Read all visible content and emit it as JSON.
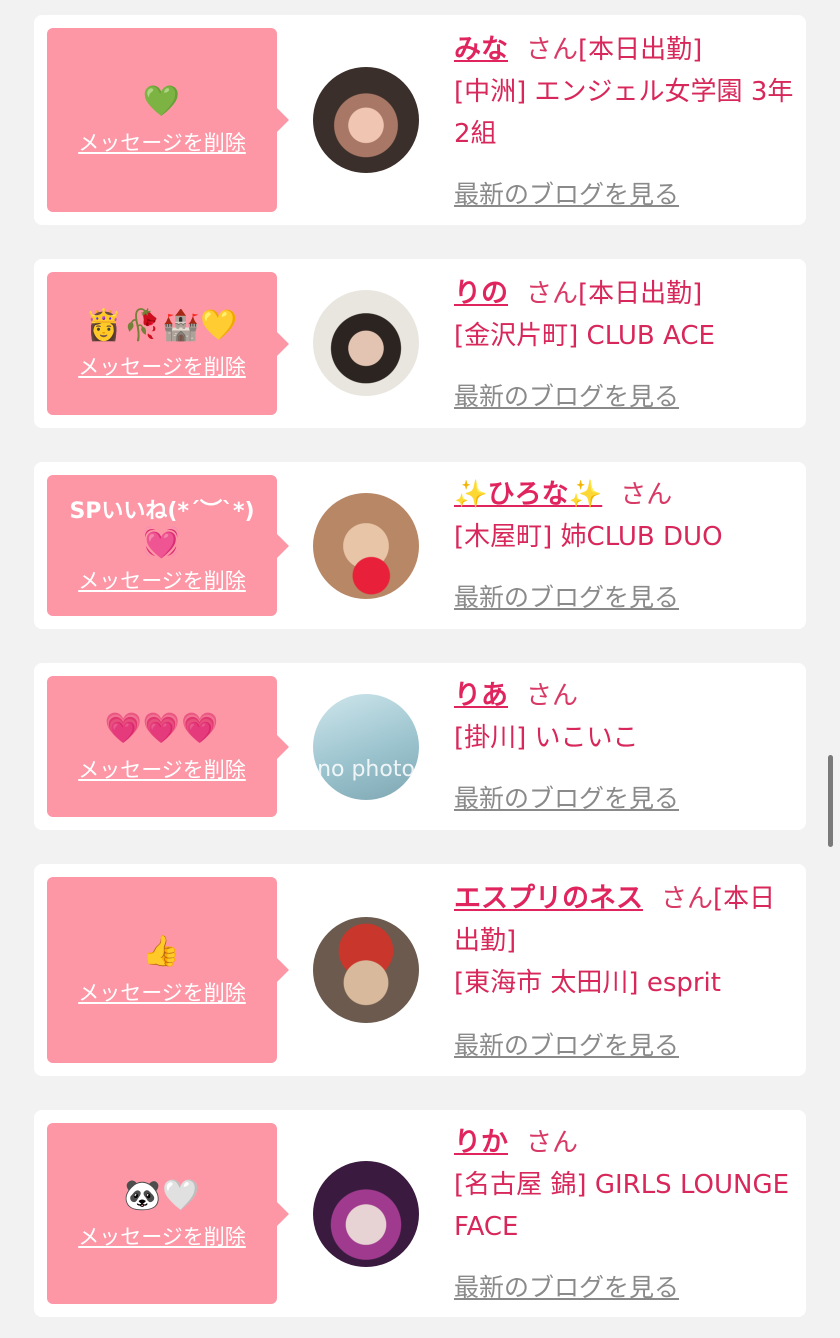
{
  "cards": [
    {
      "message_emoji": "💚",
      "delete_label": "メッセージを削除",
      "avatar_label": "",
      "name": "みな",
      "san": "さん",
      "attendance": "[本日出勤]",
      "shop": "[中洲] エンジェル女学園 3年2組",
      "blog_label": "最新のブログを見る",
      "avatar_colors": [
        "#3a2f2a",
        "#a87765",
        "#f0c6b3"
      ]
    },
    {
      "message_emoji": "👸🥀🏰💛",
      "delete_label": "メッセージを削除",
      "avatar_label": "",
      "name": "りの",
      "san": "さん",
      "attendance": "[本日出勤]",
      "shop": "[金沢片町] CLUB ACE",
      "blog_label": "最新のブログを見る",
      "avatar_colors": [
        "#e9e6df",
        "#2b2420",
        "#e3c3b1"
      ]
    },
    {
      "message_text": "SPいいね(*´︶`*)",
      "message_emoji": "💓",
      "delete_label": "メッセージを削除",
      "avatar_label": "",
      "name": "✨ひろな✨",
      "san": "さん",
      "attendance": "",
      "shop": "[木屋町] 姉CLUB DUO",
      "blog_label": "最新のブログを見る",
      "avatar_colors": [
        "#b88765",
        "#e7c5a6",
        "#e8203a"
      ]
    },
    {
      "message_emoji": "💗💗💗",
      "delete_label": "メッセージを削除",
      "avatar_label": "no photo",
      "name": "りあ",
      "san": "さん",
      "attendance": "",
      "shop": "[掛川] いこいこ",
      "blog_label": "最新のブログを見る",
      "avatar_colors": [
        "#bcdde5",
        "#9cc4cf",
        "#7fa7b3"
      ]
    },
    {
      "message_emoji": "👍",
      "delete_label": "メッセージを削除",
      "avatar_label": "",
      "name": "エスプリのネス",
      "san": "さん",
      "attendance": "[本日出勤]",
      "shop": "[東海市 太田川] esprit",
      "blog_label": "最新のブログを見る",
      "avatar_colors": [
        "#6b5a4d",
        "#c9372c",
        "#d9b99b"
      ]
    },
    {
      "message_emoji": "🐼🤍",
      "delete_label": "メッセージを削除",
      "avatar_label": "",
      "name": "りか",
      "san": "さん",
      "attendance": "",
      "shop": "[名古屋 錦] GIRLS LOUNGE FACE",
      "blog_label": "最新のブログを見る",
      "avatar_colors": [
        "#3a1a3f",
        "#a03a8e",
        "#e7d3d3"
      ]
    }
  ]
}
